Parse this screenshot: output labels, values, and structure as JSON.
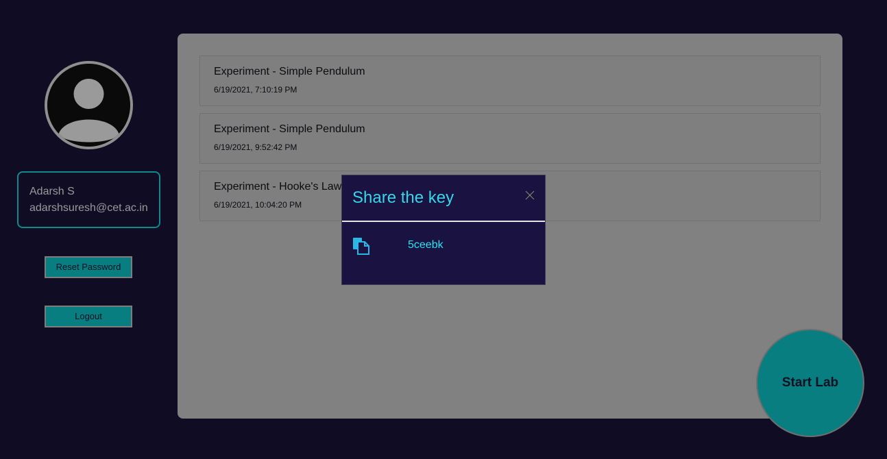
{
  "user": {
    "name": "Adarsh S",
    "email": "adarshsuresh@cet.ac.in"
  },
  "sidebar": {
    "reset_label": "Reset Password",
    "logout_label": "Logout"
  },
  "experiments": [
    {
      "title": "Experiment - Simple Pendulum",
      "time": "6/19/2021, 7:10:19 PM"
    },
    {
      "title": "Experiment - Simple Pendulum",
      "time": "6/19/2021, 9:52:42 PM"
    },
    {
      "title": "Experiment - Hooke's Law",
      "time": "6/19/2021, 10:04:20 PM"
    }
  ],
  "modal": {
    "title": "Share the key",
    "key": "5ceebk",
    "close_icon": "close-icon",
    "copy_icon": "copy-icon"
  },
  "fab": {
    "label": "Start Lab"
  },
  "colors": {
    "background": "#0f0c24",
    "accent": "#087e80",
    "modal_bg": "#1a1240",
    "modal_text": "#36d7e8"
  }
}
